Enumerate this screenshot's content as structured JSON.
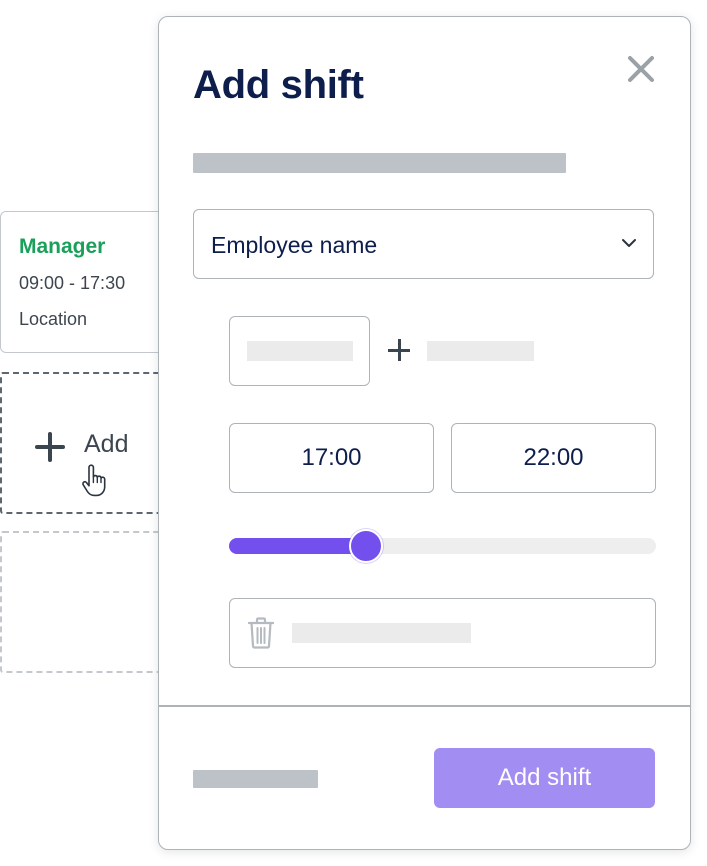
{
  "schedule": {
    "shift_card": {
      "role": "Manager",
      "time": "09:00 - 17:30",
      "location": "Location"
    },
    "add_slot": {
      "label": "Add"
    }
  },
  "modal": {
    "title": "Add shift",
    "employee_select": {
      "value": "Employee name"
    },
    "start_time": "17:00",
    "end_time": "22:00",
    "duration_slider": {
      "value_fraction": 0.32
    },
    "submit_label": "Add shift"
  },
  "icons": {
    "close": "close-icon",
    "chevron": "chevron-down-icon",
    "plus": "plus-icon",
    "trash": "trash-icon",
    "cursor": "hand-pointer-icon"
  },
  "colors": {
    "title": "#0d1e4d",
    "role": "#1aa05a",
    "accent": "#7350ee",
    "button": "#a28ef3",
    "placeholder": "#bcc2c7"
  }
}
